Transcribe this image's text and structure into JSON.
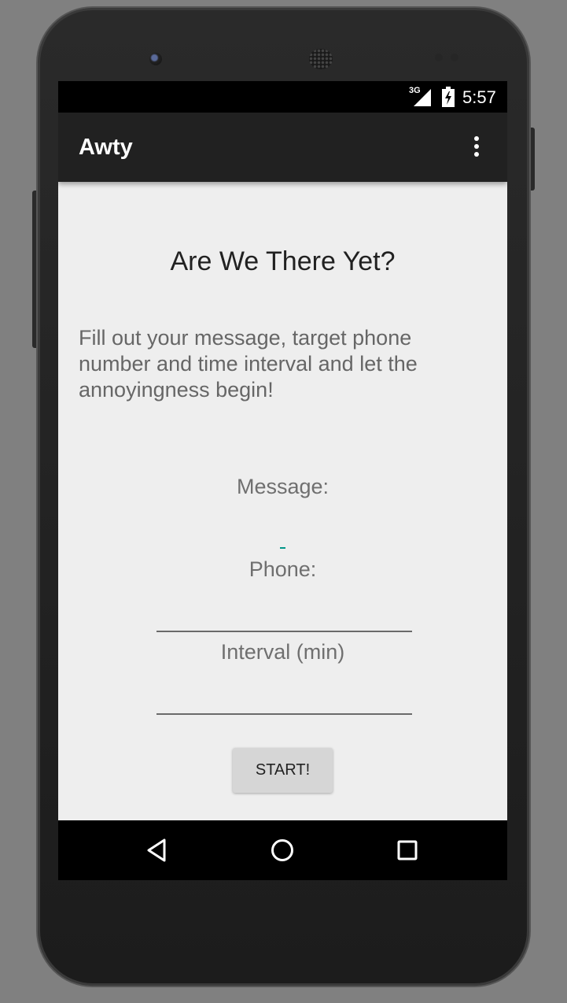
{
  "status_bar": {
    "network": "3G",
    "time": "5:57"
  },
  "app_bar": {
    "title": "Awty",
    "menu_icon": "more-vert-icon"
  },
  "main": {
    "heading": "Are We There Yet?",
    "intro": "Fill out your message, target phone number and time interval and let the annoyingness begin!",
    "message_label": "Message:",
    "message_value": "",
    "phone_label": "Phone:",
    "phone_value": "",
    "interval_label": "Interval (min)",
    "interval_value": "",
    "start_button": "START!"
  },
  "nav_bar": {
    "back_icon": "back-icon",
    "home_icon": "home-icon",
    "recents_icon": "recents-icon"
  },
  "colors": {
    "accent": "#009688",
    "app_bar": "#212121",
    "background": "#eeeeee"
  }
}
